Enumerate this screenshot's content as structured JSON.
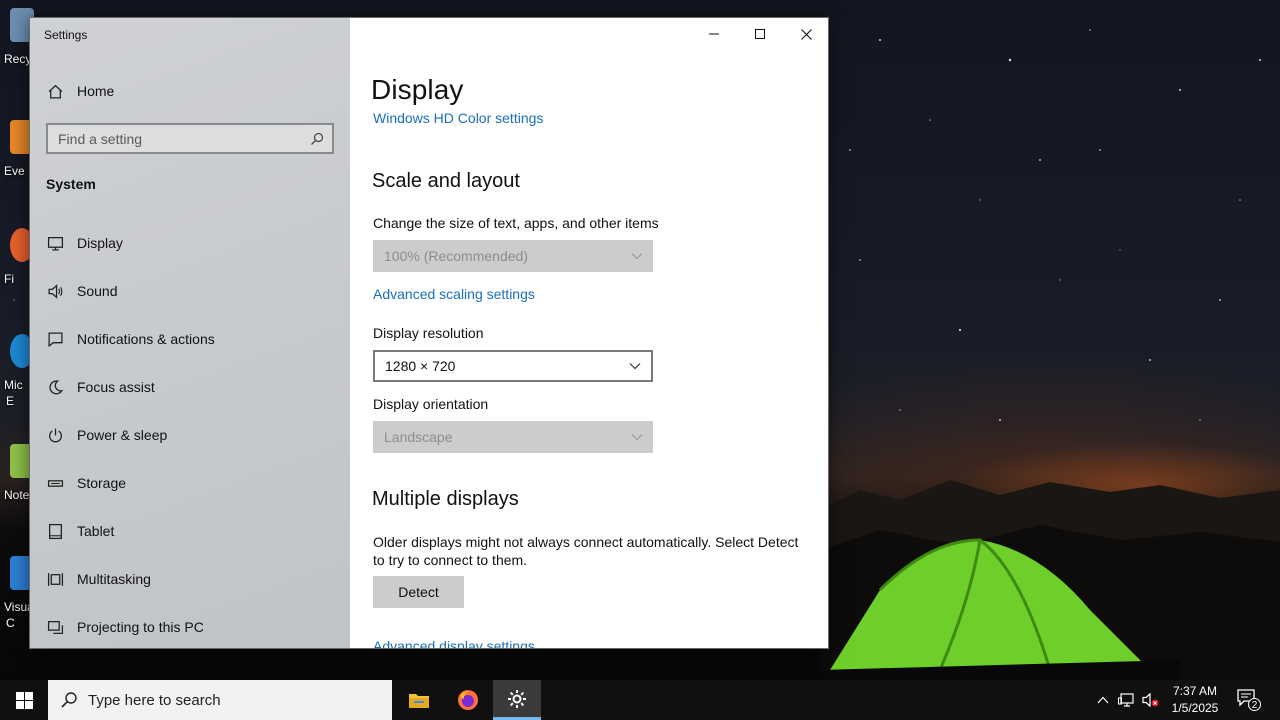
{
  "window": {
    "title": "Settings",
    "controls": {
      "minimize": "minimize",
      "maximize": "maximize",
      "close": "close"
    }
  },
  "sidebar": {
    "home_label": "Home",
    "search_placeholder": "Find a setting",
    "section_label": "System",
    "items": [
      {
        "label": "Display",
        "icon": "monitor-icon"
      },
      {
        "label": "Sound",
        "icon": "speaker-icon"
      },
      {
        "label": "Notifications & actions",
        "icon": "message-icon"
      },
      {
        "label": "Focus assist",
        "icon": "moon-icon"
      },
      {
        "label": "Power & sleep",
        "icon": "power-icon"
      },
      {
        "label": "Storage",
        "icon": "storage-icon"
      },
      {
        "label": "Tablet",
        "icon": "tablet-icon"
      },
      {
        "label": "Multitasking",
        "icon": "multitasking-icon"
      },
      {
        "label": "Projecting to this PC",
        "icon": "projecting-icon"
      }
    ]
  },
  "main": {
    "page_title": "Display",
    "hd_color_link": "Windows HD Color settings",
    "scale_heading": "Scale and layout",
    "scale_desc": "Change the size of text, apps, and other items",
    "scale_value": "100% (Recommended)",
    "advanced_scaling_link": "Advanced scaling settings",
    "resolution_label": "Display resolution",
    "resolution_value": "1280 × 720",
    "orientation_label": "Display orientation",
    "orientation_value": "Landscape",
    "multiple_heading": "Multiple displays",
    "multiple_desc_line1": "Older displays might not always connect automatically. Select Detect",
    "multiple_desc_line2": "to try to connect to them.",
    "detect_button": "Detect",
    "advanced_display_link": "Advanced display settings"
  },
  "desktop": {
    "icons": [
      {
        "label": "Recy",
        "label2": "",
        "color": "#6e8fb3"
      },
      {
        "label": "Eve",
        "label2": "",
        "color": "#e8872a"
      },
      {
        "label": "Fi",
        "label2": "",
        "color": "#e8602c"
      },
      {
        "label": "Mic",
        "label2": "E",
        "color": "#1e8ad6"
      },
      {
        "label": "Note",
        "label2": "",
        "color": "#8fc24a"
      },
      {
        "label": "Visua",
        "label2": "C",
        "color": "#2d7fd6"
      }
    ]
  },
  "taskbar": {
    "search_placeholder": "Type here to search",
    "apps": [
      "file-explorer-icon",
      "firefox-icon",
      "settings-gear-icon"
    ],
    "time": "7:37 AM",
    "date": "1/5/2025",
    "notification_count": "2"
  },
  "colors": {
    "accent_link": "#1a6fbd",
    "taskbar_active_underline": "#76b9ed",
    "sidebar_bg": "#c8cbce"
  }
}
